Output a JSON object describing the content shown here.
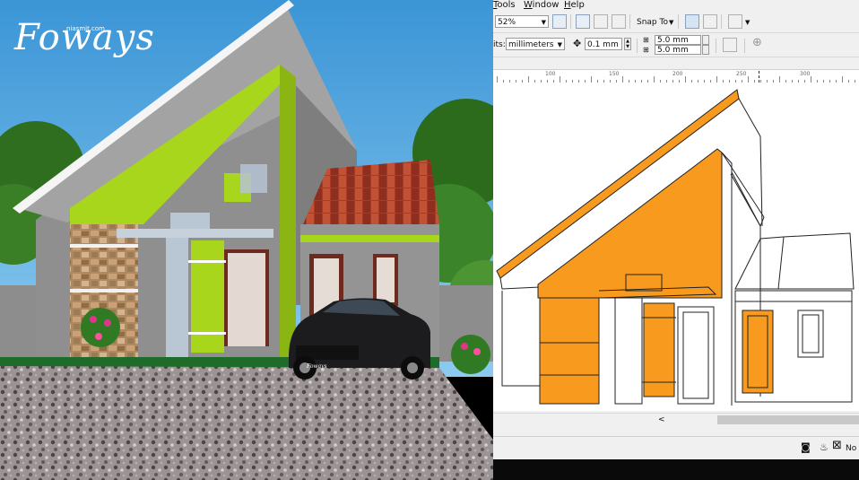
{
  "render": {
    "logo_script": "Foways",
    "logo_site": "niasmit.com",
    "car_plate": "Foways",
    "colors": {
      "sky": "#4aa3dc",
      "green_accent": "#a8d61c",
      "tile_roof": "#a83a26",
      "ground": "#1f6b29",
      "gravel": "#9a9090",
      "car": "#1c1c1e"
    }
  },
  "app": {
    "menu": [
      {
        "label": "Tools",
        "underline": "T"
      },
      {
        "label": "Window",
        "underline": "W"
      },
      {
        "label": "Help",
        "underline": "H"
      }
    ],
    "zoom_level": "52%",
    "snap_to_label": "Snap To",
    "units_label": "its:",
    "units_value": "millimeters",
    "nudge_value": "0.1 mm",
    "dup_x": "5.0 mm",
    "dup_y": "5.0 mm",
    "ruler_labels": [
      "100",
      "150",
      "200",
      "250",
      "300"
    ],
    "status_text": "No",
    "scroll_left_arrow": "<",
    "colors": {
      "drawing_fill": "#f79a1e",
      "outline": "#222222",
      "ruler_marker": "#333333"
    }
  }
}
